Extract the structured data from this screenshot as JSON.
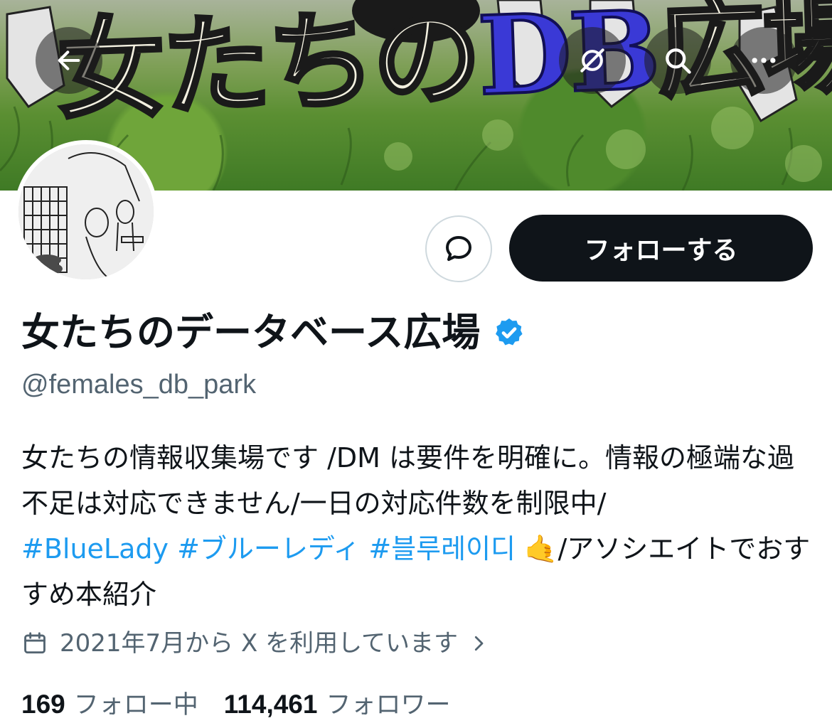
{
  "banner": {
    "title_part1": "女たちの",
    "title_part2": "DB",
    "title_part3": "広場"
  },
  "header_buttons": {
    "back_icon": "arrow-left-icon",
    "hide_icon": "eye-off-icon",
    "search_icon": "search-icon",
    "more_icon": "more-horizontal-icon"
  },
  "actions": {
    "message_icon": "message-bubble-icon",
    "follow_label": "フォローする"
  },
  "profile": {
    "display_name": "女たちのデータベース広場",
    "verified_icon": "verified-badge-icon",
    "handle": "@females_db_park",
    "bio_text_1": "女たちの情報収集場です /DM は要件を明確に。情報の極端な過不足は対応できません/一日の対応件数を制限中/",
    "bio_tag_1": "#BlueLady",
    "bio_tag_2": "#ブルーレディ",
    "bio_tag_3": "#블루레이디",
    "bio_emoji": "🤙",
    "bio_text_2": "/アソシエイトでおすすめ本紹介",
    "joined_icon": "calendar-icon",
    "joined_text": "2021年7月から X を利用しています",
    "joined_chevron": "chevron-right-icon"
  },
  "stats": {
    "following_count": "169",
    "following_label": "フォロー中",
    "followers_count": "114,461",
    "followers_label": "フォロワー"
  },
  "colors": {
    "accent_link": "#1d9bf0",
    "verified": "#1d9bf0",
    "secondary_text": "#536471",
    "primary_text": "#0f1419"
  }
}
